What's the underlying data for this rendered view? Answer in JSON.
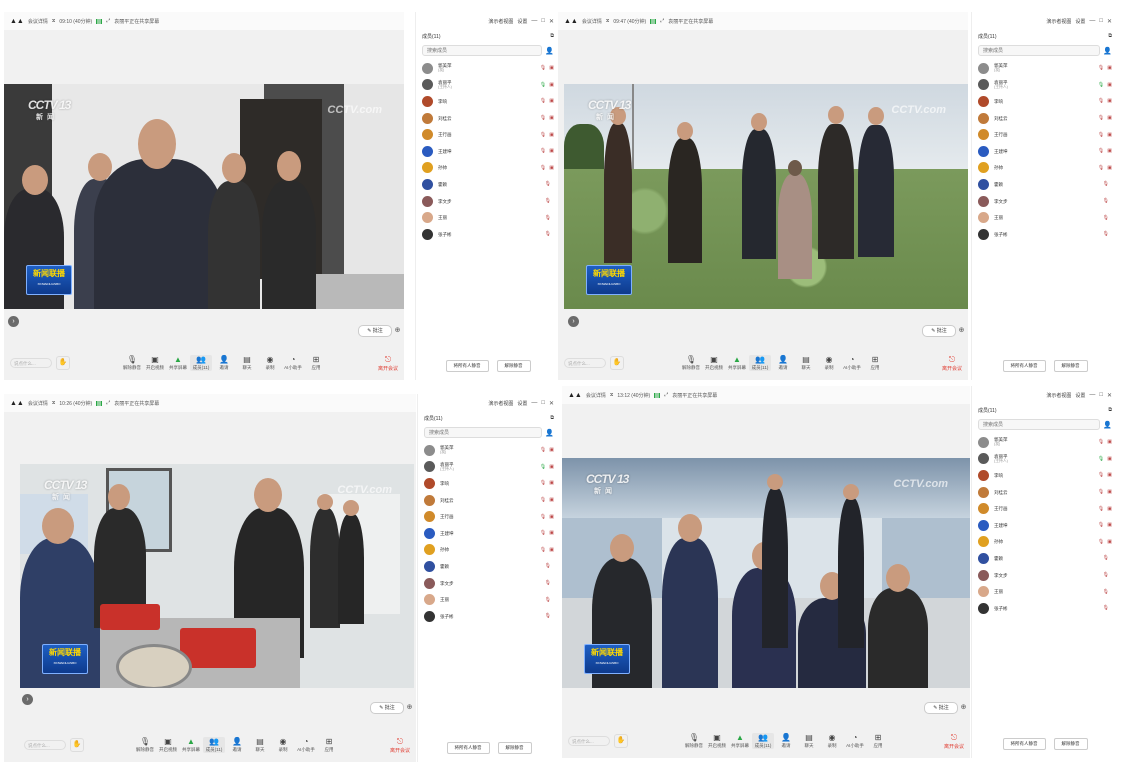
{
  "panels": [
    {
      "topbar": {
        "app": "会议详情",
        "time": "09:10 (40分钟)",
        "sharing": "袁丽平正在共享屏幕"
      },
      "side": {
        "present": "演示者视图",
        "settings": "设置"
      },
      "participants_title": "成员(11)",
      "search_placeholder": "搜索成员",
      "members": [
        {
          "name": "郭美萍",
          "sub": "(我)"
        },
        {
          "name": "袁丽平",
          "sub": "(主持人)"
        },
        {
          "name": "李响",
          "sub": ""
        },
        {
          "name": "刘桂云",
          "sub": ""
        },
        {
          "name": "王行画",
          "sub": ""
        },
        {
          "name": "王建坤",
          "sub": ""
        },
        {
          "name": "孙帅",
          "sub": ""
        },
        {
          "name": "霍颖",
          "sub": ""
        },
        {
          "name": "李文步",
          "sub": ""
        },
        {
          "name": "王丽",
          "sub": ""
        },
        {
          "name": "张子彬",
          "sub": ""
        }
      ],
      "buttons": {
        "mute_all": "将所有人静音",
        "unmute_all": "解除静音"
      },
      "chat_placeholder": "说点什么..."
    },
    {
      "topbar": {
        "app": "会议详情",
        "time": "09:47 (40分钟)",
        "sharing": "袁丽平正在共享屏幕"
      },
      "side": {
        "present": "演示者视图",
        "settings": "设置"
      },
      "participants_title": "成员(11)",
      "search_placeholder": "搜索成员",
      "members": [
        {
          "name": "郭美萍",
          "sub": "(我)"
        },
        {
          "name": "袁丽平",
          "sub": "(主持人)"
        },
        {
          "name": "李响",
          "sub": ""
        },
        {
          "name": "刘桂云",
          "sub": ""
        },
        {
          "name": "王行画",
          "sub": ""
        },
        {
          "name": "王建坤",
          "sub": ""
        },
        {
          "name": "孙帅",
          "sub": ""
        },
        {
          "name": "霍颖",
          "sub": ""
        },
        {
          "name": "李文步",
          "sub": ""
        },
        {
          "name": "王丽",
          "sub": ""
        },
        {
          "name": "张子彬",
          "sub": ""
        }
      ],
      "buttons": {
        "mute_all": "将所有人静音",
        "unmute_all": "解除静音"
      },
      "chat_placeholder": "说点什么..."
    },
    {
      "topbar": {
        "app": "会议详情",
        "time": "10:26 (40分钟)",
        "sharing": "袁丽平正在共享屏幕"
      },
      "side": {
        "present": "演示者视图",
        "settings": "设置"
      },
      "participants_title": "成员(11)",
      "search_placeholder": "搜索成员",
      "members": [
        {
          "name": "郭美萍",
          "sub": "(我)"
        },
        {
          "name": "袁丽平",
          "sub": "(主持人)"
        },
        {
          "name": "李响",
          "sub": ""
        },
        {
          "name": "刘桂云",
          "sub": ""
        },
        {
          "name": "王行画",
          "sub": ""
        },
        {
          "name": "王建坤",
          "sub": ""
        },
        {
          "name": "孙帅",
          "sub": ""
        },
        {
          "name": "霍颖",
          "sub": ""
        },
        {
          "name": "李文步",
          "sub": ""
        },
        {
          "name": "王丽",
          "sub": ""
        },
        {
          "name": "张子彬",
          "sub": ""
        }
      ],
      "buttons": {
        "mute_all": "将所有人静音",
        "unmute_all": "解除静音"
      },
      "chat_placeholder": "说点什么..."
    },
    {
      "topbar": {
        "app": "会议详情",
        "time": "13:12 (40分钟)",
        "sharing": "袁丽平正在共享屏幕"
      },
      "side": {
        "present": "演示者视图",
        "settings": "设置"
      },
      "participants_title": "成员(11)",
      "search_placeholder": "搜索成员",
      "members": [
        {
          "name": "郭美萍",
          "sub": "(我)"
        },
        {
          "name": "袁丽平",
          "sub": "(主持人)"
        },
        {
          "name": "李响",
          "sub": ""
        },
        {
          "name": "刘桂云",
          "sub": ""
        },
        {
          "name": "王行画",
          "sub": ""
        },
        {
          "name": "王建坤",
          "sub": ""
        },
        {
          "name": "孙帅",
          "sub": ""
        },
        {
          "name": "霍颖",
          "sub": ""
        },
        {
          "name": "李文步",
          "sub": ""
        },
        {
          "name": "王丽",
          "sub": ""
        },
        {
          "name": "张子彬",
          "sub": ""
        }
      ],
      "buttons": {
        "mute_all": "将所有人静音",
        "unmute_all": "解除静音"
      },
      "chat_placeholder": "说点什么..."
    }
  ],
  "video": {
    "channel": "CCTV 13",
    "channel_sub": "新 闻",
    "watermark": "CCTV.com",
    "program": "新闻联播",
    "program_en": "XINWENLIANBO"
  },
  "toolbar": [
    "解除静音",
    "开启视频",
    "共享屏幕",
    "成员(11)",
    "邀请",
    "聊天",
    "录制",
    "AI小助手",
    "应用"
  ],
  "leave_label": "离开会议",
  "annotate_label": "批注",
  "colors": {
    "accent": "#e03a2f",
    "green": "#2aa745",
    "news_blue": "#1e5fc4"
  }
}
